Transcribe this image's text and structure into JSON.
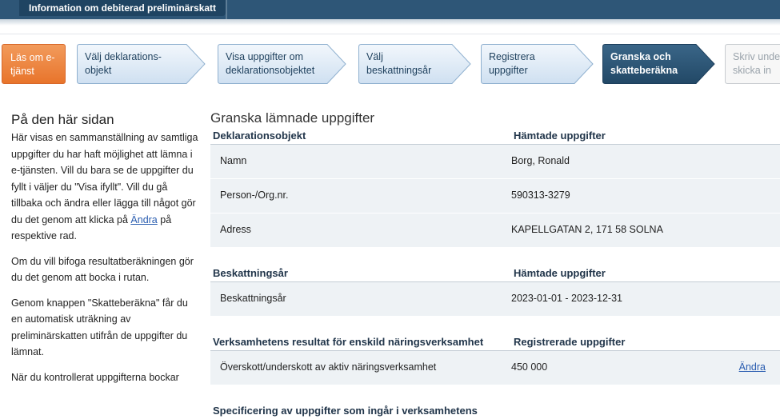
{
  "header": {
    "title": "Information om debiterad preliminärskatt"
  },
  "steps": [
    {
      "label_line1": "Läs om e-",
      "label_line2": "tjänst"
    },
    {
      "label_line1": "Välj deklarations-",
      "label_line2": "objekt"
    },
    {
      "label_line1": "Visa uppgifter om",
      "label_line2": "deklarationsobjektet"
    },
    {
      "label_line1": "Välj",
      "label_line2": "beskattningsår"
    },
    {
      "label_line1": "Registrera",
      "label_line2": "uppgifter"
    },
    {
      "label_line1": "Granska och",
      "label_line2": "skatteberäkna"
    },
    {
      "label_line1": "Skriv unde",
      "label_line2": "skicka in"
    }
  ],
  "sidebar": {
    "title": "På den här sidan",
    "p1_before": "Här visas en sammanställning av samtliga uppgifter du har haft möjlighet att lämna i e-tjänsten. Vill du bara se de uppgifter du fyllt i väljer du \"Visa ifyllt\". Vill du gå tillbaka och ändra eller lägga till något gör du det genom att klicka på ",
    "p1_link": "Ändra",
    "p1_after": " på respektive rad.",
    "p2": "Om du vill bifoga resultatberäkningen gör du det genom att bocka i rutan.",
    "p3": "Genom knappen \"Skatteberäkna\" får du en automatisk uträkning av preliminärskatten utifrån de uppgifter du lämnat.",
    "p4": "När du kontrollerat uppgifterna bockar"
  },
  "main": {
    "title": "Granska lämnade uppgifter",
    "section1": {
      "col1": "Deklarationsobjekt",
      "col2": "Hämtade uppgifter",
      "rows": [
        {
          "label": "Namn",
          "value": "Borg, Ronald"
        },
        {
          "label": "Person-/Org.nr.",
          "value": "590313-3279"
        },
        {
          "label": "Adress",
          "value": "KAPELLGATAN 2, 171 58 SOLNA"
        }
      ]
    },
    "section2": {
      "col1": "Beskattningsår",
      "col2": "Hämtade uppgifter",
      "rows": [
        {
          "label": "Beskattningsår",
          "value": "2023-01-01 - 2023-12-31"
        }
      ]
    },
    "section3": {
      "col1": "Verksamhetens resultat för enskild näringsverksamhet",
      "col2": "Registrerade uppgifter",
      "rows": [
        {
          "label": "Överskott/underskott av aktiv näringsverksamhet",
          "value": "450 000",
          "action": "Ändra"
        }
      ]
    },
    "section4": {
      "col1": "Specificering av uppgifter som ingår i verksamhetens"
    }
  },
  "colors": {
    "header": "#2e5677",
    "step_first": "#e8742b",
    "step_normal_fill": "#dce9f6",
    "step_active": "#2c5574",
    "link": "#2a5db0",
    "row_bg": "#eef2f5"
  }
}
